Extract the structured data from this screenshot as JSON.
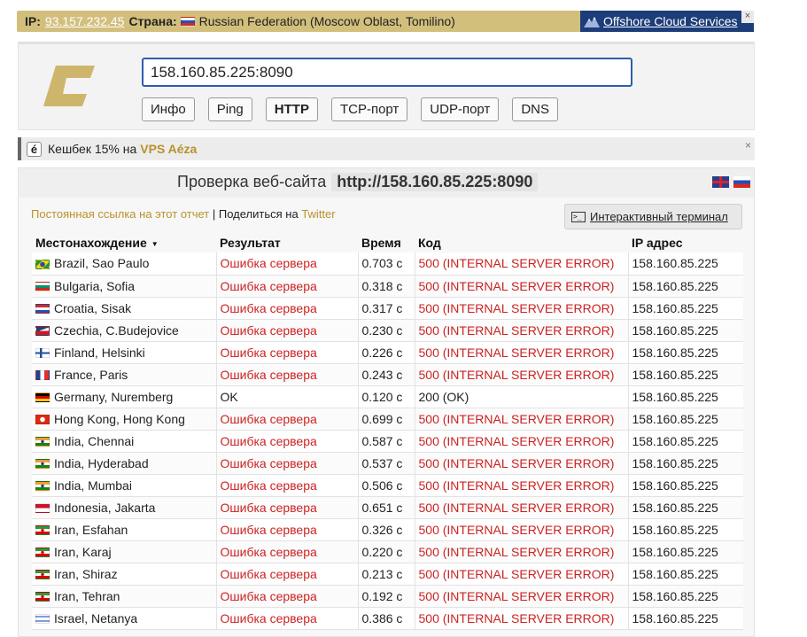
{
  "ipbar": {
    "ip_label": "IP",
    "ip_value": "93.157.232.45",
    "country_label": "Страна",
    "country_value": "Russian Federation (Moscow Oblast, Tomilino)",
    "ad_text": "Offshore Cloud Services",
    "close": "×"
  },
  "search": {
    "host_value": "158.160.85.225:8090",
    "buttons": [
      "Инфо",
      "Ping",
      "HTTP",
      "TCP-порт",
      "UDP-порт",
      "DNS"
    ],
    "active": "HTTP"
  },
  "cashback": {
    "icon": "é",
    "text": "Кешбек 15% на",
    "highlight": "VPS Aéza",
    "close": "×"
  },
  "result": {
    "title": "Проверка веб-сайта",
    "url": "http://158.160.85.225:8090",
    "permalink": "Постоянная ссылка на этот отчет",
    "share": "Поделиться на",
    "twitter": "Twitter",
    "terminal": "Интерактивный терминал",
    "columns": [
      "Местонахождение",
      "Результат",
      "Время",
      "Код",
      "IP адрес"
    ],
    "sort_indicator": "▼",
    "rows": [
      {
        "flag": "br",
        "location": "Brazil, Sao Paulo",
        "result": "Ошибка сервера",
        "time": "0.703 с",
        "code": "500 (INTERNAL SERVER ERROR)",
        "ip": "158.160.85.225",
        "ok": false
      },
      {
        "flag": "bg",
        "location": "Bulgaria, Sofia",
        "result": "Ошибка сервера",
        "time": "0.318 с",
        "code": "500 (INTERNAL SERVER ERROR)",
        "ip": "158.160.85.225",
        "ok": false
      },
      {
        "flag": "hr",
        "location": "Croatia, Sisak",
        "result": "Ошибка сервера",
        "time": "0.317 с",
        "code": "500 (INTERNAL SERVER ERROR)",
        "ip": "158.160.85.225",
        "ok": false
      },
      {
        "flag": "cz",
        "location": "Czechia, C.Budejovice",
        "result": "Ошибка сервера",
        "time": "0.230 с",
        "code": "500 (INTERNAL SERVER ERROR)",
        "ip": "158.160.85.225",
        "ok": false
      },
      {
        "flag": "fi",
        "location": "Finland, Helsinki",
        "result": "Ошибка сервера",
        "time": "0.226 с",
        "code": "500 (INTERNAL SERVER ERROR)",
        "ip": "158.160.85.225",
        "ok": false
      },
      {
        "flag": "fr",
        "location": "France, Paris",
        "result": "Ошибка сервера",
        "time": "0.243 с",
        "code": "500 (INTERNAL SERVER ERROR)",
        "ip": "158.160.85.225",
        "ok": false
      },
      {
        "flag": "de",
        "location": "Germany, Nuremberg",
        "result": "OK",
        "time": "0.120 с",
        "code": "200 (OK)",
        "ip": "158.160.85.225",
        "ok": true
      },
      {
        "flag": "hk",
        "location": "Hong Kong, Hong Kong",
        "result": "Ошибка сервера",
        "time": "0.699 с",
        "code": "500 (INTERNAL SERVER ERROR)",
        "ip": "158.160.85.225",
        "ok": false
      },
      {
        "flag": "in",
        "location": "India, Chennai",
        "result": "Ошибка сервера",
        "time": "0.587 с",
        "code": "500 (INTERNAL SERVER ERROR)",
        "ip": "158.160.85.225",
        "ok": false
      },
      {
        "flag": "in",
        "location": "India, Hyderabad",
        "result": "Ошибка сервера",
        "time": "0.537 с",
        "code": "500 (INTERNAL SERVER ERROR)",
        "ip": "158.160.85.225",
        "ok": false
      },
      {
        "flag": "in",
        "location": "India, Mumbai",
        "result": "Ошибка сервера",
        "time": "0.506 с",
        "code": "500 (INTERNAL SERVER ERROR)",
        "ip": "158.160.85.225",
        "ok": false
      },
      {
        "flag": "id",
        "location": "Indonesia, Jakarta",
        "result": "Ошибка сервера",
        "time": "0.651 с",
        "code": "500 (INTERNAL SERVER ERROR)",
        "ip": "158.160.85.225",
        "ok": false
      },
      {
        "flag": "ir",
        "location": "Iran, Esfahan",
        "result": "Ошибка сервера",
        "time": "0.326 с",
        "code": "500 (INTERNAL SERVER ERROR)",
        "ip": "158.160.85.225",
        "ok": false
      },
      {
        "flag": "ir",
        "location": "Iran, Karaj",
        "result": "Ошибка сервера",
        "time": "0.220 с",
        "code": "500 (INTERNAL SERVER ERROR)",
        "ip": "158.160.85.225",
        "ok": false
      },
      {
        "flag": "ir",
        "location": "Iran, Shiraz",
        "result": "Ошибка сервера",
        "time": "0.213 с",
        "code": "500 (INTERNAL SERVER ERROR)",
        "ip": "158.160.85.225",
        "ok": false
      },
      {
        "flag": "ir",
        "location": "Iran, Tehran",
        "result": "Ошибка сервера",
        "time": "0.192 с",
        "code": "500 (INTERNAL SERVER ERROR)",
        "ip": "158.160.85.225",
        "ok": false
      },
      {
        "flag": "il",
        "location": "Israel, Netanya",
        "result": "Ошибка сервера",
        "time": "0.386 с",
        "code": "500 (INTERNAL SERVER ERROR)",
        "ip": "158.160.85.225",
        "ok": false
      }
    ]
  },
  "colors": {
    "gold": "#b8922b",
    "ipbar_bg": "#d2bf7c",
    "error_red": "#cc2222",
    "ad_bg": "#1d3d7a",
    "input_border": "#2c5fa8"
  }
}
